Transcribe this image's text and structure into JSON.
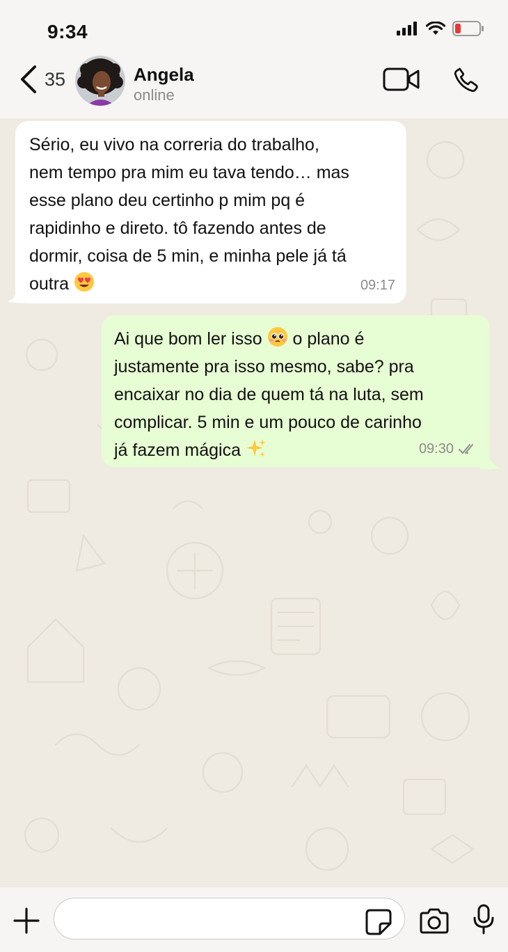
{
  "status_bar": {
    "time": "9:34",
    "battery_color": "#e53935"
  },
  "header": {
    "back_count": "35",
    "contact_name": "Angela",
    "contact_status": "online"
  },
  "messages": [
    {
      "direction": "incoming",
      "text": "Sério, eu vivo na correria do trabalho,\nnem tempo pra mim eu tava tendo… mas\nesse plano deu certinho p mim pq é\nrapidinho e direto. tô fazendo antes de\ndormir, coisa de 5 min, e minha pele já tá\noutra",
      "emoji_icon": "heart-eyes-emoji-icon",
      "time": "09:17"
    },
    {
      "direction": "outgoing",
      "text_part1": "Ai que bom ler isso",
      "emoji1_icon": "pleading-face-emoji-icon",
      "text_part2": " o plano é\njustamente pra isso mesmo, sabe? pra\nencaixar no dia de quem tá na luta, sem\ncomplicar. 5 min e um pouco de carinho\njá fazem mágica",
      "emoji2_icon": "sparkles-emoji-icon",
      "time": "09:30",
      "status_icon": "double-check-icon"
    }
  ],
  "input": {
    "placeholder": ""
  },
  "colors": {
    "incoming_bubble": "#ffffff",
    "outgoing_bubble": "#e7fdd3",
    "chat_background": "#efeae2",
    "bar_background": "#f6f5f3"
  }
}
